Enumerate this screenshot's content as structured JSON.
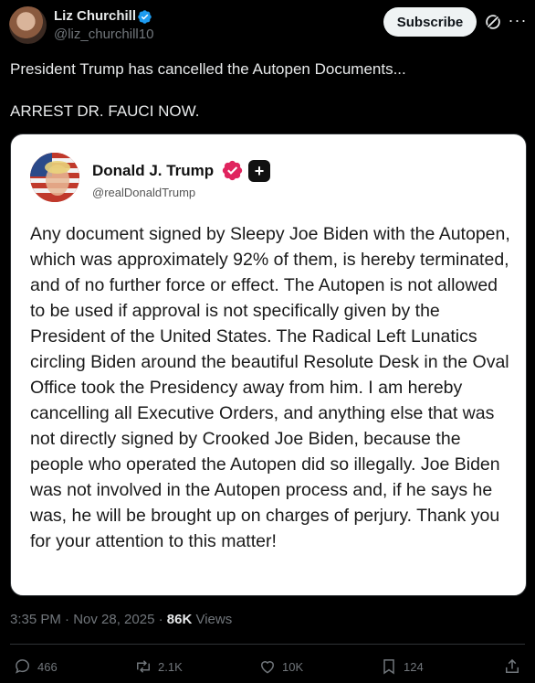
{
  "author": {
    "name": "Liz Churchill",
    "handle": "@liz_churchill10",
    "verified_color": "#1d9bf0"
  },
  "header": {
    "subscribe_label": "Subscribe",
    "grok_icon": "grok-icon",
    "more_icon": "more-icon"
  },
  "tweet": {
    "line1": "President Trump has cancelled the Autopen Documents...",
    "line2": "ARREST DR. FAUCI NOW."
  },
  "embedded": {
    "name": "Donald J. Trump",
    "handle": "@realDonaldTrump",
    "badge_color": "#e0245e",
    "body": "Any document signed by Sleepy Joe Biden with the Autopen, which was approximately 92% of them, is hereby terminated, and of no further force or effect. The Autopen is not allowed to be used if approval is not specifically given by the President of the United States. The Radical Left Lunatics circling Biden around the beautiful Resolute Desk in the Oval Office took the Presidency away from him. I am hereby cancelling all Executive Orders, and anything else that was not directly signed by Crooked Joe Biden, because the people who operated the Autopen did so illegally. Joe Biden was not involved in the Autopen process and, if he says he was, he will be brought up on charges of perjury. Thank you for your attention to this matter!"
  },
  "meta": {
    "time": "3:35 PM · Nov 28, 2025 · ",
    "views_count": "86K",
    "views_label": " Views"
  },
  "actions": {
    "replies": "466",
    "reposts": "2.1K",
    "likes": "10K",
    "bookmarks": "124"
  }
}
